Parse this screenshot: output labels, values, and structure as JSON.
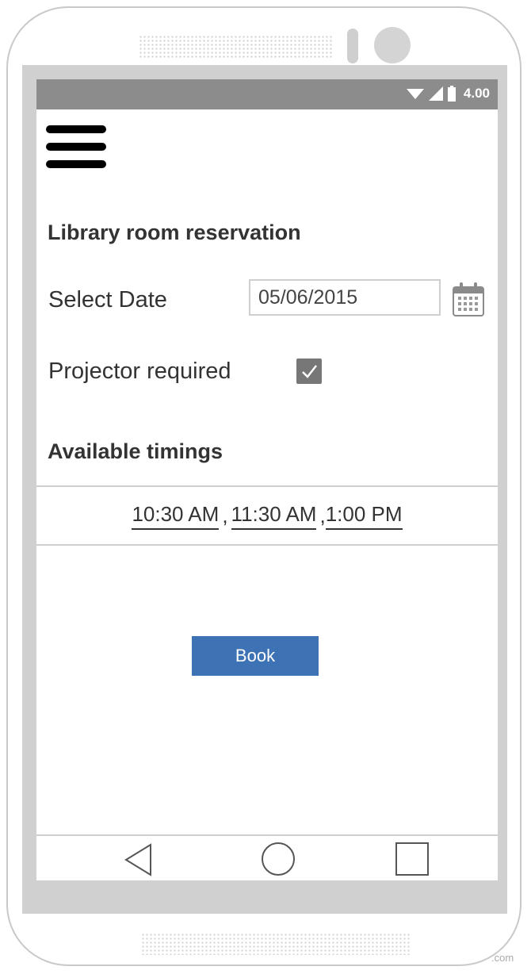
{
  "status_bar": {
    "time": "4.00",
    "icons": [
      "wifi-icon",
      "signal-icon",
      "battery-icon"
    ]
  },
  "header": {
    "menu_icon": "hamburger-menu-icon"
  },
  "form": {
    "title": "Library room reservation",
    "select_date_label": "Select Date",
    "date_value": "05/06/2015",
    "calendar_icon": "calendar-icon",
    "projector_label": "Projector required",
    "projector_checked": true
  },
  "timings": {
    "section_title": "Available timings",
    "slots": [
      "10:30 AM",
      "11:30 AM",
      "1:00 PM"
    ],
    "separators": [
      " , ",
      " ,"
    ]
  },
  "actions": {
    "book_label": "Book"
  },
  "navbar": {
    "icons": [
      "back-icon",
      "home-icon",
      "recent-apps-icon"
    ]
  },
  "watermark": ".com",
  "colors": {
    "status_bar": "#8c8c8c",
    "button": "#3d72b4",
    "bezel": "#d0d0d0",
    "checkbox": "#777777"
  }
}
